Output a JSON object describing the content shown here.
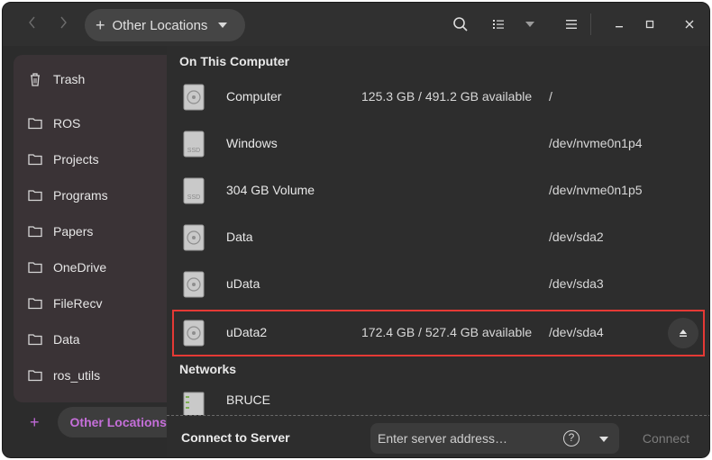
{
  "header": {
    "location_label": "Other Locations",
    "back_icon": "chevron-left-icon",
    "forward_icon": "chevron-right-icon"
  },
  "sidebar": {
    "items": [
      {
        "label": "Trash",
        "icon": "trash-icon"
      },
      {
        "label": "ROS",
        "icon": "folder-icon"
      },
      {
        "label": "Projects",
        "icon": "folder-icon"
      },
      {
        "label": "Programs",
        "icon": "folder-icon"
      },
      {
        "label": "Papers",
        "icon": "folder-icon"
      },
      {
        "label": "OneDrive",
        "icon": "folder-icon"
      },
      {
        "label": "FileRecv",
        "icon": "folder-icon"
      },
      {
        "label": "Data",
        "icon": "folder-icon"
      },
      {
        "label": "ros_utils",
        "icon": "folder-icon"
      }
    ],
    "other_locations": {
      "label": "Other Locations",
      "icon": "plus-icon"
    }
  },
  "main": {
    "on_this_computer": "On This Computer",
    "drives": [
      {
        "name": "Computer",
        "available": "125.3 GB / 491.2 GB available",
        "device": "/",
        "icon": "hard-disk-icon"
      },
      {
        "name": "Windows",
        "available": "",
        "device": "/dev/nvme0n1p4",
        "icon": "ssd-icon"
      },
      {
        "name": "304 GB Volume",
        "available": "",
        "device": "/dev/nvme0n1p5",
        "icon": "ssd-icon"
      },
      {
        "name": "Data",
        "available": "",
        "device": "/dev/sda2",
        "icon": "hard-disk-icon"
      },
      {
        "name": "uData",
        "available": "",
        "device": "/dev/sda3",
        "icon": "hard-disk-icon"
      },
      {
        "name": "uData2",
        "available": "172.4 GB / 527.4 GB available",
        "device": "/dev/sda4",
        "icon": "hard-disk-icon",
        "eject": "eject-icon"
      }
    ],
    "networks": "Networks",
    "network_items": [
      {
        "name": "BRUCE",
        "icon": "network-server-icon"
      }
    ]
  },
  "connect": {
    "label": "Connect to Server",
    "placeholder": "Enter server address…",
    "button": "Connect",
    "help": "?"
  },
  "colors": {
    "accent": "#c56fd9",
    "highlight_border": "#e53935"
  }
}
